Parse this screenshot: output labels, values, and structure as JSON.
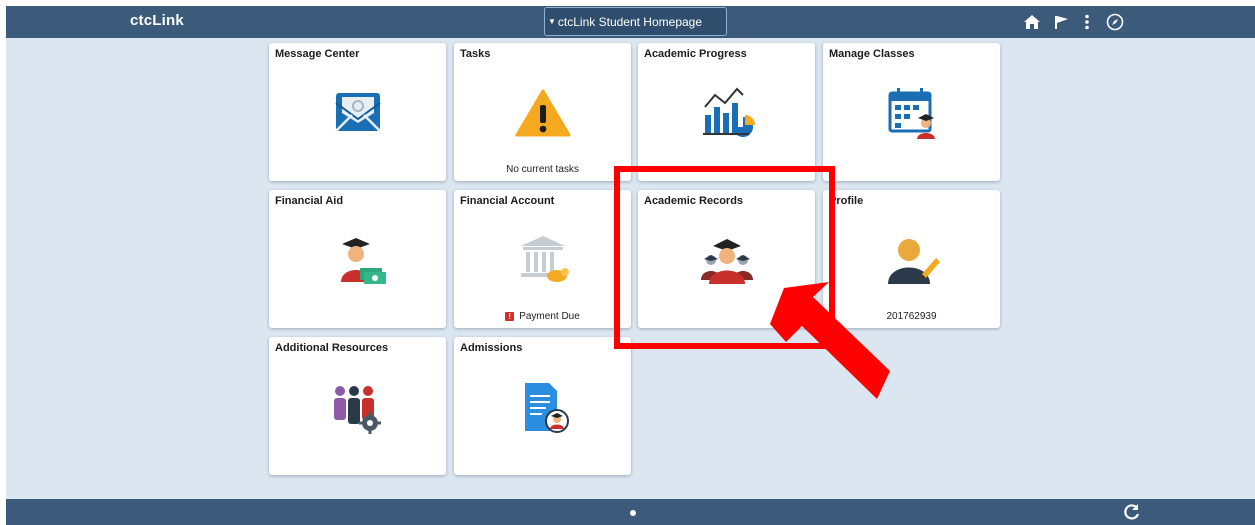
{
  "header": {
    "logo": "ctcLink",
    "homepage_selector": "ctcLink Student Homepage",
    "icons": [
      "home-icon",
      "flag-icon",
      "more-vertical-icon",
      "compass-icon"
    ]
  },
  "tiles": {
    "message_center": {
      "title": "Message Center",
      "icon": "envelope-icon"
    },
    "tasks": {
      "title": "Tasks",
      "icon": "warning-icon",
      "sub": "No current tasks"
    },
    "academic_progress": {
      "title": "Academic Progress",
      "icon": "chart-icon"
    },
    "manage_classes": {
      "title": "Manage Classes",
      "icon": "calendar-icon"
    },
    "financial_aid": {
      "title": "Financial Aid",
      "icon": "graduate-money-icon"
    },
    "financial_account": {
      "title": "Financial Account",
      "icon": "bank-icon",
      "sub": "Payment Due",
      "badge": "!"
    },
    "academic_records": {
      "title": "Academic Records",
      "icon": "graduates-icon"
    },
    "profile": {
      "title": "Profile",
      "icon": "user-edit-icon",
      "sub": "201762939"
    },
    "additional_resources": {
      "title": "Additional Resources",
      "icon": "people-gear-icon"
    },
    "admissions": {
      "title": "Admissions",
      "icon": "document-graduate-icon"
    }
  },
  "footer": {
    "icons": [
      "page-indicator-dot",
      "refresh-icon"
    ]
  },
  "colors": {
    "header_bg": "#3c5a79",
    "page_bg": "#dbe6f0",
    "tile_bg": "#ffffff",
    "highlight": "#ff0000"
  }
}
